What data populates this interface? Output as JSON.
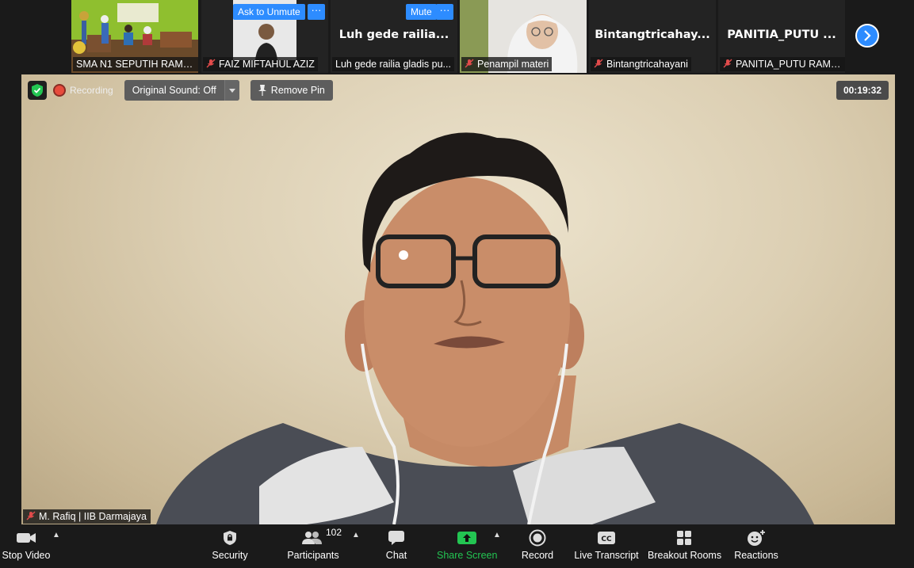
{
  "strip": {
    "tiles": [
      {
        "name": "SMA N1 SEPUTIH RAMAN",
        "muted": false
      },
      {
        "name": "FAIZ MIFTAHUL AZIZ",
        "muted": true,
        "button": "Ask to Unmute",
        "more": "···"
      },
      {
        "name": "Luh gede railia gladis pu...",
        "big": "Luh gede railia...",
        "muted": false,
        "button": "Mute",
        "more": "···"
      },
      {
        "name": "Penampil materi",
        "muted": true
      },
      {
        "name": "Bintangtricahayani",
        "big": "Bintangtricahay...",
        "muted": true
      },
      {
        "name": "PANITIA_PUTU RAMA...",
        "big": "PANITIA_PUTU ...",
        "muted": true
      }
    ],
    "next_icon": "chevron-right-icon"
  },
  "meeting": {
    "recording_label": "Recording",
    "original_sound": "Original Sound: Off",
    "remove_pin": "Remove Pin",
    "timer": "00:19:32",
    "speaker_name": "M. Rafiq | IIB Darmajaya",
    "accent_color": "#2d8cff",
    "record_color": "#e74c3c",
    "shield_color": "#23c552"
  },
  "toolbar": {
    "stop_video": "Stop Video",
    "security": "Security",
    "participants": "Participants",
    "participants_count": "102",
    "chat": "Chat",
    "share_screen": "Share Screen",
    "record": "Record",
    "live_transcript": "Live Transcript",
    "breakout_rooms": "Breakout Rooms",
    "reactions": "Reactions",
    "share_color": "#23c552"
  }
}
